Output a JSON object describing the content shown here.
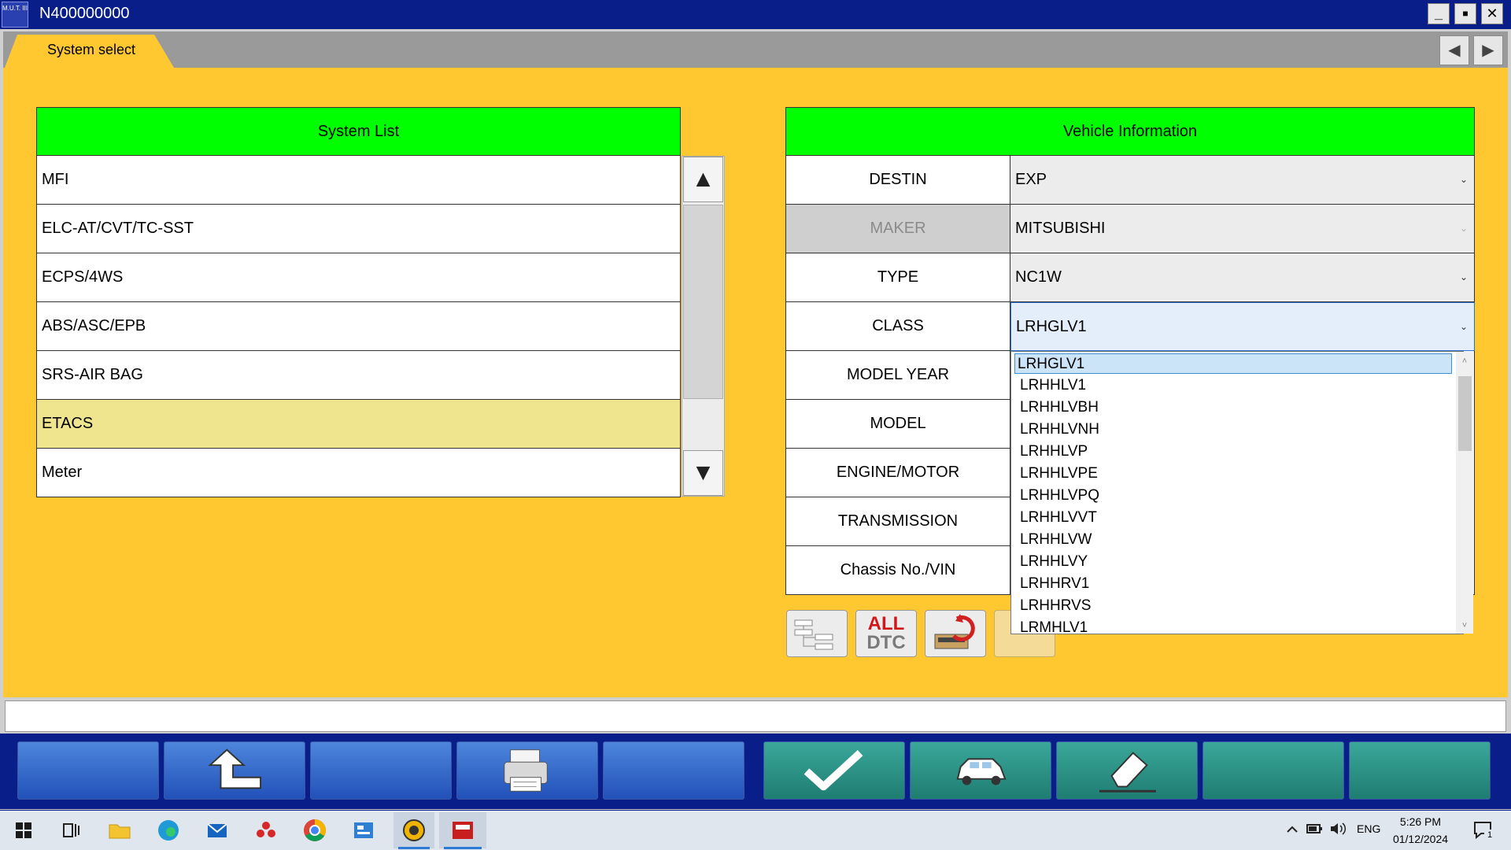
{
  "window": {
    "title": "N400000000",
    "logo_text": "M.U.T. III",
    "minimize": "_",
    "maximize": "■",
    "close": "✕"
  },
  "tabs": [
    {
      "label": "System select"
    }
  ],
  "nav": {
    "prev": "◀",
    "next": "▶"
  },
  "system_list": {
    "header": "System List",
    "items": [
      "MFI",
      "ELC-AT/CVT/TC-SST",
      "ECPS/4WS",
      "ABS/ASC/EPB",
      "SRS-AIR BAG",
      "ETACS",
      "Meter"
    ],
    "selected": "ETACS",
    "scroll_up": "▲",
    "scroll_down": "▼"
  },
  "vehicle_info": {
    "header": "Vehicle Information",
    "rows": [
      {
        "label": "DESTIN",
        "value": "EXP"
      },
      {
        "label": "MAKER",
        "value": "MITSUBISHI"
      },
      {
        "label": "TYPE",
        "value": "NC1W"
      },
      {
        "label": "CLASS",
        "value": "LRHGLV1"
      },
      {
        "label": "MODEL YEAR",
        "value": ""
      },
      {
        "label": "MODEL",
        "value": ""
      },
      {
        "label": "ENGINE/MOTOR",
        "value": ""
      },
      {
        "label": "TRANSMISSION",
        "value": ""
      },
      {
        "label": "Chassis No./VIN",
        "value": ""
      }
    ],
    "chevron": "⌄"
  },
  "class_dropdown": {
    "options": [
      "LRHGLV1",
      "LRHHLV1",
      "LRHHLVBH",
      "LRHHLVNH",
      "LRHHLVP",
      "LRHHLVPE",
      "LRHHLVPQ",
      "LRHHLVVT",
      "LRHHLVW",
      "LRHHLVY",
      "LRHHRV1",
      "LRHHRVS",
      "LRMHLV1"
    ],
    "highlighted": "LRHGLV1",
    "up": "˄",
    "down": "˅"
  },
  "tool_buttons": {
    "all_dtc_line1": "ALL",
    "all_dtc_line2": "DTC"
  },
  "taskbar": {
    "language": "ENG",
    "time": "5:26 PM",
    "date": "01/12/2024",
    "notification_count": "1"
  },
  "colors": {
    "panel": "#ffc830",
    "header_green": "#00ff00",
    "title_bar": "#0a1e8a",
    "selected_row": "#efe58f"
  }
}
